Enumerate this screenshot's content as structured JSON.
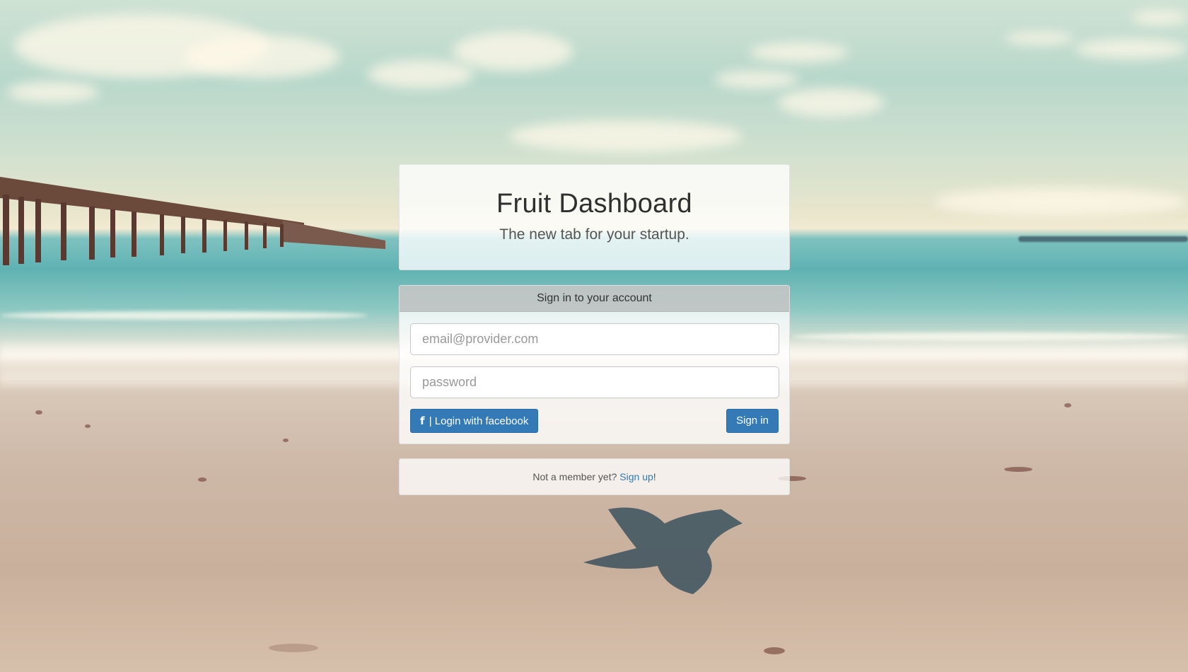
{
  "brand": {
    "title": "Fruit Dashboard",
    "tagline": "The new tab for your startup."
  },
  "signin": {
    "header": "Sign in to your account",
    "email_placeholder": "email@provider.com",
    "password_placeholder": "password",
    "facebook_icon": "facebook-icon",
    "facebook_label": "| Login with facebook",
    "signin_label": "Sign in"
  },
  "signup": {
    "prompt": "Not a member yet?",
    "link_label": "Sign up",
    "suffix": "!"
  },
  "colors": {
    "primary_button": "#337ab7",
    "link": "#337ab7"
  }
}
